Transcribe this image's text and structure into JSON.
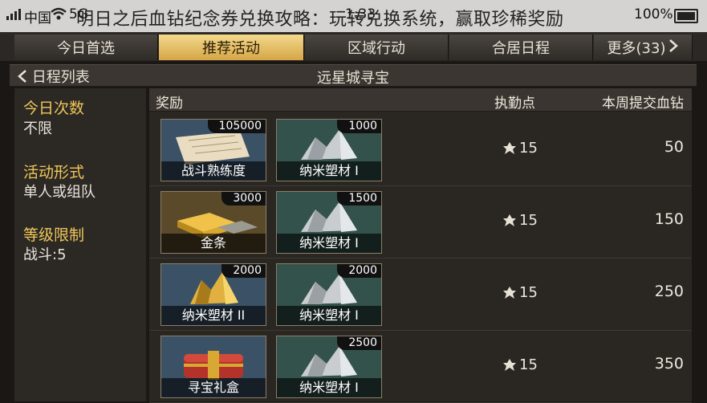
{
  "status": {
    "carrier": "中国",
    "network": "5G",
    "time": "1:33",
    "battery": "100%"
  },
  "overlay_title": "明日之后血钻纪念券兑换攻略：玩转兑换系统，赢取珍稀奖励",
  "tabs": [
    {
      "label": "今日首选",
      "active": false
    },
    {
      "label": "推荐活动",
      "active": true
    },
    {
      "label": "区域行动",
      "active": false
    },
    {
      "label": "合居日程",
      "active": false
    },
    {
      "label": "更多(33)",
      "active": false
    }
  ],
  "subheader": {
    "back_label": "日程列表",
    "title": "远星城寻宝"
  },
  "sidebar": [
    {
      "label": "今日次数",
      "value": "不限"
    },
    {
      "label": "活动形式",
      "value": "单人或组队"
    },
    {
      "label": "等级限制",
      "value": "战斗:5"
    }
  ],
  "table": {
    "headers": {
      "reward": "奖励",
      "duty": "执勤点",
      "blood": "本周提交血钻"
    },
    "rows": [
      {
        "items": [
          {
            "name": "战斗熟练度",
            "qty": "105000",
            "art": "paper"
          },
          {
            "name": "纳米塑材 I",
            "qty": "1000",
            "art": "silver"
          }
        ],
        "duty": "15",
        "blood": "50"
      },
      {
        "items": [
          {
            "name": "金条",
            "qty": "3000",
            "art": "gold"
          },
          {
            "name": "纳米塑材 I",
            "qty": "1500",
            "art": "silver"
          }
        ],
        "duty": "15",
        "blood": "150"
      },
      {
        "items": [
          {
            "name": "纳米塑材 II",
            "qty": "2000",
            "art": "goldcrystal"
          },
          {
            "name": "纳米塑材 I",
            "qty": "2000",
            "art": "silver"
          }
        ],
        "duty": "15",
        "blood": "250"
      },
      {
        "items": [
          {
            "name": "寻宝礼盒",
            "qty": "",
            "art": "chest"
          },
          {
            "name": "纳米塑材 I",
            "qty": "2500",
            "art": "silver"
          }
        ],
        "duty": "15",
        "blood": "350"
      }
    ]
  },
  "colors": {
    "accent": "#f0c75a",
    "active_tab": "#e8c36a"
  }
}
